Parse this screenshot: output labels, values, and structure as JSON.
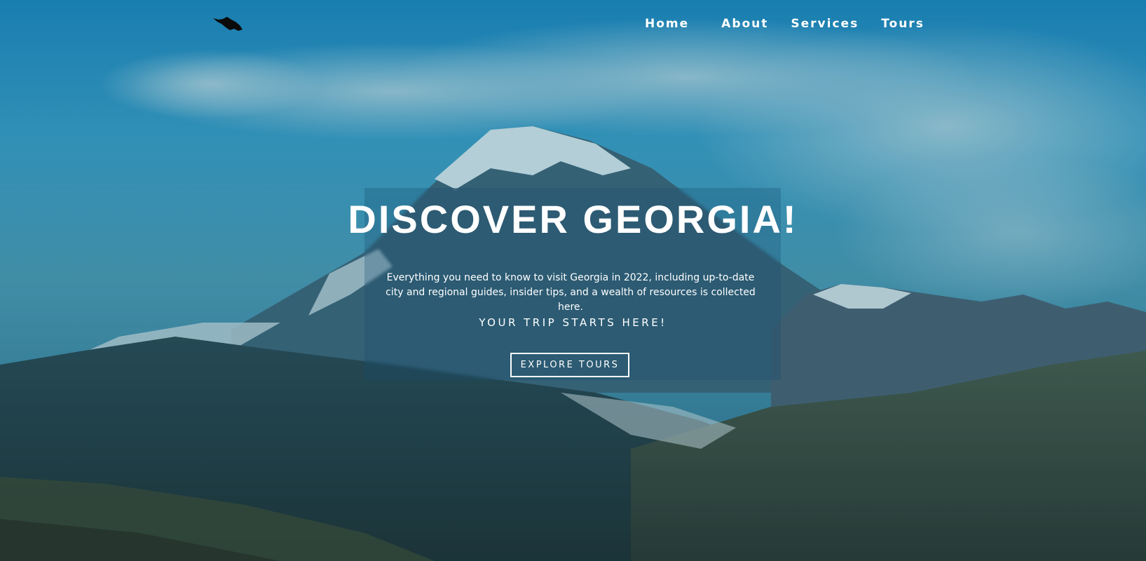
{
  "nav": {
    "logo_icon": "georgia-map-icon",
    "items": [
      {
        "label": "Home"
      },
      {
        "label": "About"
      },
      {
        "label": "Services"
      },
      {
        "label": "Tours"
      }
    ]
  },
  "hero": {
    "headline": "DISCOVER GEORGIA!",
    "subtitle": "Everything you need to know to visit Georgia in 2022, including up-to-date city and regional guides, insider tips, and a wealth of resources is collected here.",
    "tagline": "YOUR TRIP STARTS HERE!",
    "cta_label": "EXPLORE TOURS"
  },
  "colors": {
    "sky": "#2a95c5",
    "overlay": "#144b6e",
    "text": "#ffffff"
  }
}
